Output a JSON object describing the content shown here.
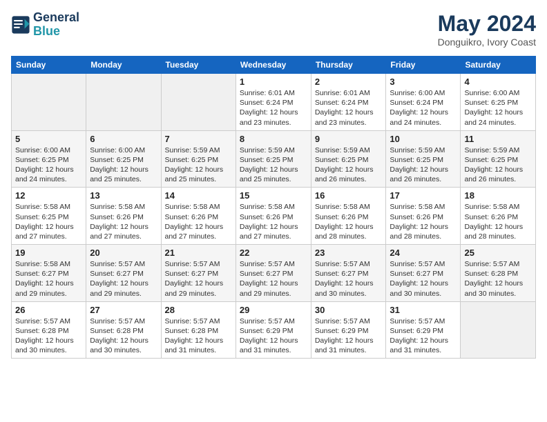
{
  "header": {
    "logo_line1": "General",
    "logo_line2": "Blue",
    "month": "May 2024",
    "location": "Donguikro, Ivory Coast"
  },
  "weekdays": [
    "Sunday",
    "Monday",
    "Tuesday",
    "Wednesday",
    "Thursday",
    "Friday",
    "Saturday"
  ],
  "weeks": [
    [
      {
        "day": "",
        "info": ""
      },
      {
        "day": "",
        "info": ""
      },
      {
        "day": "",
        "info": ""
      },
      {
        "day": "1",
        "info": "Sunrise: 6:01 AM\nSunset: 6:24 PM\nDaylight: 12 hours\nand 23 minutes."
      },
      {
        "day": "2",
        "info": "Sunrise: 6:01 AM\nSunset: 6:24 PM\nDaylight: 12 hours\nand 23 minutes."
      },
      {
        "day": "3",
        "info": "Sunrise: 6:00 AM\nSunset: 6:24 PM\nDaylight: 12 hours\nand 24 minutes."
      },
      {
        "day": "4",
        "info": "Sunrise: 6:00 AM\nSunset: 6:25 PM\nDaylight: 12 hours\nand 24 minutes."
      }
    ],
    [
      {
        "day": "5",
        "info": "Sunrise: 6:00 AM\nSunset: 6:25 PM\nDaylight: 12 hours\nand 24 minutes."
      },
      {
        "day": "6",
        "info": "Sunrise: 6:00 AM\nSunset: 6:25 PM\nDaylight: 12 hours\nand 25 minutes."
      },
      {
        "day": "7",
        "info": "Sunrise: 5:59 AM\nSunset: 6:25 PM\nDaylight: 12 hours\nand 25 minutes."
      },
      {
        "day": "8",
        "info": "Sunrise: 5:59 AM\nSunset: 6:25 PM\nDaylight: 12 hours\nand 25 minutes."
      },
      {
        "day": "9",
        "info": "Sunrise: 5:59 AM\nSunset: 6:25 PM\nDaylight: 12 hours\nand 26 minutes."
      },
      {
        "day": "10",
        "info": "Sunrise: 5:59 AM\nSunset: 6:25 PM\nDaylight: 12 hours\nand 26 minutes."
      },
      {
        "day": "11",
        "info": "Sunrise: 5:59 AM\nSunset: 6:25 PM\nDaylight: 12 hours\nand 26 minutes."
      }
    ],
    [
      {
        "day": "12",
        "info": "Sunrise: 5:58 AM\nSunset: 6:25 PM\nDaylight: 12 hours\nand 27 minutes."
      },
      {
        "day": "13",
        "info": "Sunrise: 5:58 AM\nSunset: 6:26 PM\nDaylight: 12 hours\nand 27 minutes."
      },
      {
        "day": "14",
        "info": "Sunrise: 5:58 AM\nSunset: 6:26 PM\nDaylight: 12 hours\nand 27 minutes."
      },
      {
        "day": "15",
        "info": "Sunrise: 5:58 AM\nSunset: 6:26 PM\nDaylight: 12 hours\nand 27 minutes."
      },
      {
        "day": "16",
        "info": "Sunrise: 5:58 AM\nSunset: 6:26 PM\nDaylight: 12 hours\nand 28 minutes."
      },
      {
        "day": "17",
        "info": "Sunrise: 5:58 AM\nSunset: 6:26 PM\nDaylight: 12 hours\nand 28 minutes."
      },
      {
        "day": "18",
        "info": "Sunrise: 5:58 AM\nSunset: 6:26 PM\nDaylight: 12 hours\nand 28 minutes."
      }
    ],
    [
      {
        "day": "19",
        "info": "Sunrise: 5:58 AM\nSunset: 6:27 PM\nDaylight: 12 hours\nand 29 minutes."
      },
      {
        "day": "20",
        "info": "Sunrise: 5:57 AM\nSunset: 6:27 PM\nDaylight: 12 hours\nand 29 minutes."
      },
      {
        "day": "21",
        "info": "Sunrise: 5:57 AM\nSunset: 6:27 PM\nDaylight: 12 hours\nand 29 minutes."
      },
      {
        "day": "22",
        "info": "Sunrise: 5:57 AM\nSunset: 6:27 PM\nDaylight: 12 hours\nand 29 minutes."
      },
      {
        "day": "23",
        "info": "Sunrise: 5:57 AM\nSunset: 6:27 PM\nDaylight: 12 hours\nand 30 minutes."
      },
      {
        "day": "24",
        "info": "Sunrise: 5:57 AM\nSunset: 6:27 PM\nDaylight: 12 hours\nand 30 minutes."
      },
      {
        "day": "25",
        "info": "Sunrise: 5:57 AM\nSunset: 6:28 PM\nDaylight: 12 hours\nand 30 minutes."
      }
    ],
    [
      {
        "day": "26",
        "info": "Sunrise: 5:57 AM\nSunset: 6:28 PM\nDaylight: 12 hours\nand 30 minutes."
      },
      {
        "day": "27",
        "info": "Sunrise: 5:57 AM\nSunset: 6:28 PM\nDaylight: 12 hours\nand 30 minutes."
      },
      {
        "day": "28",
        "info": "Sunrise: 5:57 AM\nSunset: 6:28 PM\nDaylight: 12 hours\nand 31 minutes."
      },
      {
        "day": "29",
        "info": "Sunrise: 5:57 AM\nSunset: 6:29 PM\nDaylight: 12 hours\nand 31 minutes."
      },
      {
        "day": "30",
        "info": "Sunrise: 5:57 AM\nSunset: 6:29 PM\nDaylight: 12 hours\nand 31 minutes."
      },
      {
        "day": "31",
        "info": "Sunrise: 5:57 AM\nSunset: 6:29 PM\nDaylight: 12 hours\nand 31 minutes."
      },
      {
        "day": "",
        "info": ""
      }
    ]
  ]
}
